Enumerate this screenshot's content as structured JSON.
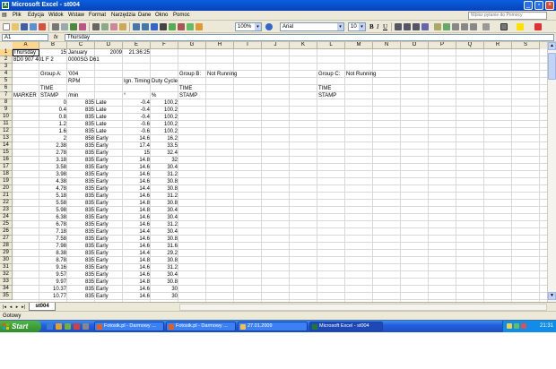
{
  "window": {
    "title": "Microsoft Excel - st004",
    "app_icon": "excel-icon"
  },
  "menubar": {
    "items": [
      "Plik",
      "Edycja",
      "Widok",
      "Wstaw",
      "Format",
      "Narzędzia",
      "Dane",
      "Okno",
      "Pomoc"
    ],
    "help_placeholder": "Wpisz pytanie do Pomocy"
  },
  "toolbar": {
    "zoom": "100%",
    "font": "Arial",
    "font_size": "10",
    "bold": "B",
    "italic": "I",
    "underline": "U"
  },
  "formula_bar": {
    "name_box": "A1",
    "fx": "fx",
    "content": "Thursday"
  },
  "columns": [
    "A",
    "B",
    "C",
    "D",
    "E",
    "F",
    "G",
    "H",
    "I",
    "J",
    "K",
    "L",
    "M",
    "N",
    "O",
    "P",
    "Q",
    "R",
    "S"
  ],
  "rows": [
    "1",
    "2",
    "3",
    "4",
    "5",
    "6",
    "7",
    "8",
    "9",
    "10",
    "11",
    "12",
    "13",
    "14",
    "15",
    "16",
    "17",
    "18",
    "19",
    "20",
    "21",
    "22",
    "23",
    "24",
    "25",
    "26",
    "27",
    "28",
    "29",
    "30",
    "31",
    "32",
    "33",
    "34",
    "35"
  ],
  "header_cells": {
    "a1": "Thursday",
    "b1": "15",
    "c1": "January",
    "d1": "2009",
    "e1": "21:36:25",
    "a2": "8D0 907 401 F 2",
    "c2": "0000SG  D61",
    "b4": "Group A:",
    "c4": "'004",
    "g4": "Group B:",
    "h4": "Not Running",
    "l4": "Group C:",
    "m4": "Not Running",
    "c5": "RPM",
    "e5": "Ign. Timing",
    "f5": "Duty Cycle",
    "b6": "TIME",
    "g6": "TIME",
    "l6": "TIME",
    "a7": "MARKER",
    "b7": "STAMP",
    "c7": "/min",
    "e7": "°",
    "f7": "%",
    "g7": "STAMP",
    "l7": "STAMP"
  },
  "data_rows": [
    [
      "0",
      "835",
      "Late",
      "-0.4",
      "100.2"
    ],
    [
      "0.4",
      "835",
      "Late",
      "-0.4",
      "100.2"
    ],
    [
      "0.8",
      "835",
      "Late",
      "-0.4",
      "100.2"
    ],
    [
      "1.2",
      "835",
      "Late",
      "-0.6",
      "100.2"
    ],
    [
      "1.6",
      "835",
      "Late",
      "-0.6",
      "100.2"
    ],
    [
      "2",
      "858",
      "Early",
      "14.6",
      "16.2"
    ],
    [
      "2.38",
      "835",
      "Early",
      "17.4",
      "33.5"
    ],
    [
      "2.78",
      "835",
      "Early",
      "15",
      "32.4"
    ],
    [
      "3.18",
      "835",
      "Early",
      "14.8",
      "32"
    ],
    [
      "3.58",
      "835",
      "Early",
      "14.6",
      "30.4"
    ],
    [
      "3.98",
      "835",
      "Early",
      "14.6",
      "31.2"
    ],
    [
      "4.38",
      "835",
      "Early",
      "14.6",
      "30.8"
    ],
    [
      "4.78",
      "835",
      "Early",
      "14.4",
      "30.8"
    ],
    [
      "5.18",
      "835",
      "Early",
      "14.6",
      "31.2"
    ],
    [
      "5.58",
      "835",
      "Early",
      "14.8",
      "30.8"
    ],
    [
      "5.98",
      "835",
      "Early",
      "14.8",
      "30.4"
    ],
    [
      "6.38",
      "835",
      "Early",
      "14.6",
      "30.4"
    ],
    [
      "6.78",
      "835",
      "Early",
      "14.6",
      "31.2"
    ],
    [
      "7.18",
      "835",
      "Early",
      "14.4",
      "30.4"
    ],
    [
      "7.58",
      "835",
      "Early",
      "14.6",
      "30.8"
    ],
    [
      "7.98",
      "835",
      "Early",
      "14.6",
      "31.6"
    ],
    [
      "8.38",
      "835",
      "Early",
      "14.4",
      "29.2"
    ],
    [
      "8.78",
      "835",
      "Early",
      "14.8",
      "30.8"
    ],
    [
      "9.16",
      "835",
      "Early",
      "14.6",
      "31.2"
    ],
    [
      "9.57",
      "835",
      "Early",
      "14.6",
      "30.4"
    ],
    [
      "9.97",
      "835",
      "Early",
      "14.8",
      "30.8"
    ],
    [
      "10.37",
      "835",
      "Early",
      "14.6",
      "30"
    ],
    [
      "10.77",
      "835",
      "Early",
      "14.6",
      "30"
    ]
  ],
  "sheet_tabs": [
    "st004"
  ],
  "status": "Gotowy",
  "taskbar": {
    "start": "Start",
    "tasks": [
      "Fotosik.pl - Darmowy ...",
      "Fotosik.pl - Darmowy ...",
      "27.01.2009",
      "Microsoft Excel - st004"
    ],
    "clock": "21:31"
  },
  "colors": {
    "title_blue": "#0a5fe0",
    "excel_green": "#1d7a2e",
    "header_selected": "#ffd68b",
    "taskbar_blue": "#245edb",
    "start_green": "#3a9d35"
  }
}
